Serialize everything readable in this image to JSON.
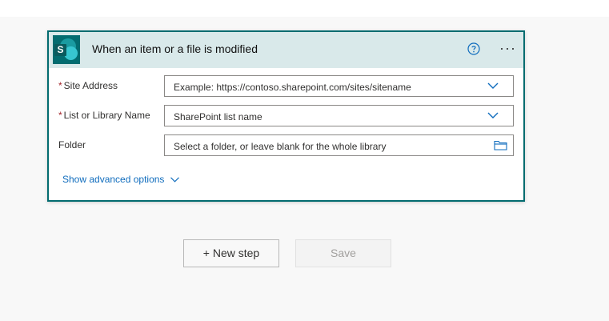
{
  "trigger": {
    "title": "When an item or a file is modified",
    "connector_icon": "sharepoint-logo",
    "logo_letter": "S",
    "help_icon": "question-circle-icon",
    "more_icon": "ellipsis-icon",
    "more_label": "···"
  },
  "fields": {
    "site_address": {
      "label": "Site Address",
      "required_marker": "*",
      "placeholder": "Example: https://contoso.sharepoint.com/sites/sitename"
    },
    "list_name": {
      "label": "List or Library Name",
      "required_marker": "*",
      "placeholder": "SharePoint list name"
    },
    "folder": {
      "label": "Folder",
      "placeholder": "Select a folder, or leave blank for the whole library"
    }
  },
  "advanced": {
    "label": "Show advanced options"
  },
  "actions": {
    "new_step": "+ New step",
    "save": "Save"
  },
  "colors": {
    "accent": "#036c70",
    "header_bg": "#d9e9ea",
    "link": "#0f6cbd",
    "required": "#a4262c"
  }
}
